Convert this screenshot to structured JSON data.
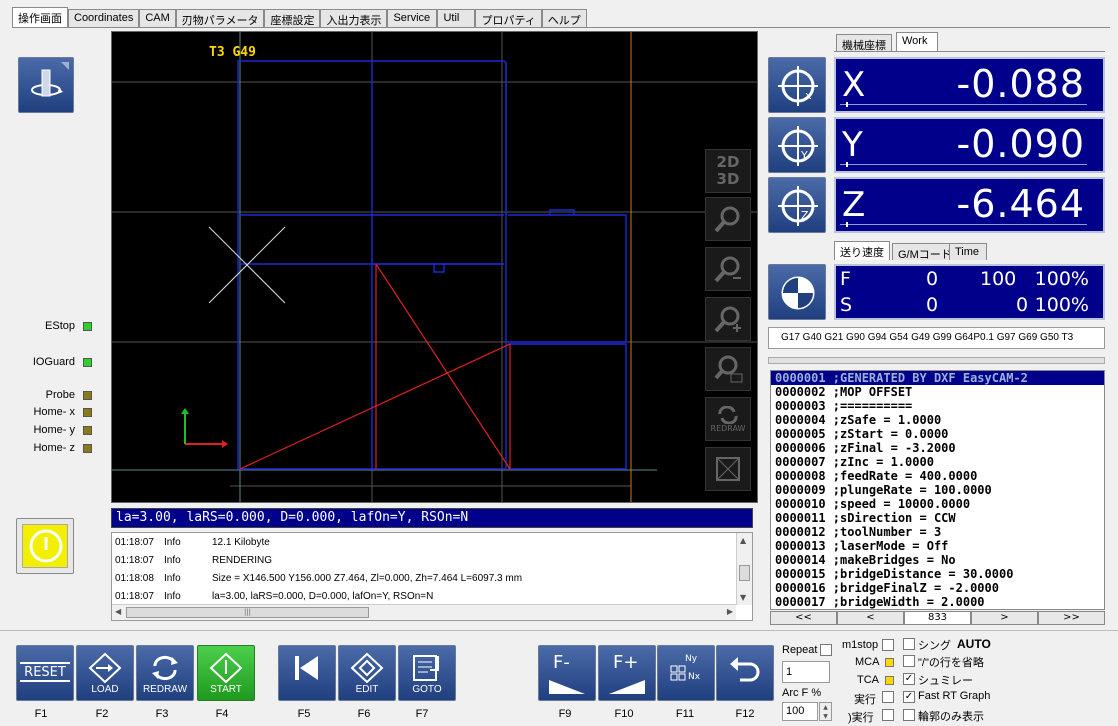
{
  "tabs": [
    "操作画面",
    "Coordinates",
    "CAM",
    "刃物パラメータ",
    "座標設定",
    "入出力表示",
    "Service",
    "Util",
    "プロパティ",
    "ヘルプ"
  ],
  "leds": [
    {
      "label": "EStop",
      "color": "#2dd02d"
    },
    {
      "label": "IOGuard",
      "color": "#2dd02d"
    },
    {
      "label": "Probe",
      "color": "#8a7a1a"
    },
    {
      "label": "Home- x",
      "color": "#8a7a1a"
    },
    {
      "label": "Home- y",
      "color": "#8a7a1a"
    },
    {
      "label": "Home- z",
      "color": "#8a7a1a"
    }
  ],
  "viewport": {
    "label": "T3 G49",
    "tools": [
      "2D\n3D",
      "zoom-fit-icon",
      "zoom-out-icon",
      "zoom-in-icon",
      "zoom-window-icon",
      "REDRAW",
      "cube-view-icon"
    ]
  },
  "status_line": "la=3.00, laRS=0.000, D=0.000, lafOn=Y, RSOn=N",
  "log": [
    {
      "time": "01:18:07",
      "level": "Info",
      "msg": "12.1 Kilobyte"
    },
    {
      "time": "01:18:07",
      "level": "Info",
      "msg": "RENDERING"
    },
    {
      "time": "01:18:08",
      "level": "Info",
      "msg": "Size = X146.500 Y156.000 Z7.464, Zl=0.000, Zh=7.464 L=6097.3 mm"
    },
    {
      "time": "01:18:07",
      "level": "Info",
      "msg": "la=3.00, laRS=0.000, D=0.000, lafOn=Y, RSOn=N"
    }
  ],
  "coord_tabs": [
    "機械座標",
    "Work"
  ],
  "dro": [
    {
      "axis": "X",
      "value": "-0.088"
    },
    {
      "axis": "Y",
      "value": "-0.090"
    },
    {
      "axis": "Z",
      "value": "-6.464"
    }
  ],
  "feed_tabs": [
    "送り速度",
    "G/Mコード",
    "Time"
  ],
  "feed": {
    "f_label": "F",
    "f_val1": "0",
    "f_val2": "100",
    "f_pct": "100%",
    "s_label": "S",
    "s_val1": "0",
    "s_val2": "0",
    "s_pct": "100%"
  },
  "modal_codes": "G17 G40 G21 G90 G94 G54 G49 G99 G64P0.1 G97 G69 G50 T3",
  "gcode_lines": [
    "0000001 ;GENERATED BY DXF EasyCAM-2",
    "0000002 ;MOP OFFSET",
    "0000003 ;==========",
    "0000004 ;zSafe  = 1.0000",
    "0000005 ;zStart = 0.0000",
    "0000006 ;zFinal = -3.2000",
    "0000007 ;zInc = 1.0000",
    "0000008 ;feedRate = 400.0000",
    "0000009 ;plungeRate = 100.0000",
    "0000010 ;speed = 10000.0000",
    "0000011 ;sDirection = CCW",
    "0000012 ;toolNumber = 3",
    "0000013 ;laserMode = Off",
    "0000014 ;makeBridges = No",
    "0000015 ;bridgeDistance = 30.0000",
    "0000016 ;bridgeFinalZ = -2.0000",
    "0000017 ;bridgeWidth = 2.0000"
  ],
  "gcode_nav": [
    "<<",
    "<",
    "833",
    ">",
    ">>"
  ],
  "function_buttons": [
    {
      "label": "RESET",
      "key": "F1"
    },
    {
      "label": "LOAD",
      "key": "F2"
    },
    {
      "label": "REDRAW",
      "key": "F3"
    },
    {
      "label": "START",
      "key": "F4"
    },
    {
      "label": "",
      "key": "F5"
    },
    {
      "label": "EDIT",
      "key": "F6"
    },
    {
      "label": "GOTO",
      "key": "F7"
    },
    {
      "label": "F-",
      "key": "F9"
    },
    {
      "label": "F+",
      "key": "F10"
    },
    {
      "label": "Ny Nx",
      "key": "F11"
    },
    {
      "label": "",
      "key": "F12"
    }
  ],
  "repeat": {
    "label": "Repeat",
    "value": "1"
  },
  "arc": {
    "label": "Arc F %",
    "value": "100"
  },
  "options_left": [
    {
      "label": "m1stop",
      "indicator": "checkbox"
    },
    {
      "label": "MCA",
      "indicator": "yellow"
    },
    {
      "label": "TCA",
      "indicator": "yellow"
    },
    {
      "label": "実行",
      "indicator": "checkbox"
    },
    {
      "label": ")実行",
      "indicator": "checkbox"
    }
  ],
  "options_right": [
    {
      "label": "シング",
      "checked": false
    },
    {
      "label": "\"/\"の行を省略",
      "checked": false
    },
    {
      "label": "シュミレー",
      "checked": true
    },
    {
      "label": "Fast RT Graph",
      "checked": true
    },
    {
      "label": "輪郭のみ表示",
      "checked": false
    }
  ],
  "auto_label": "AUTO"
}
